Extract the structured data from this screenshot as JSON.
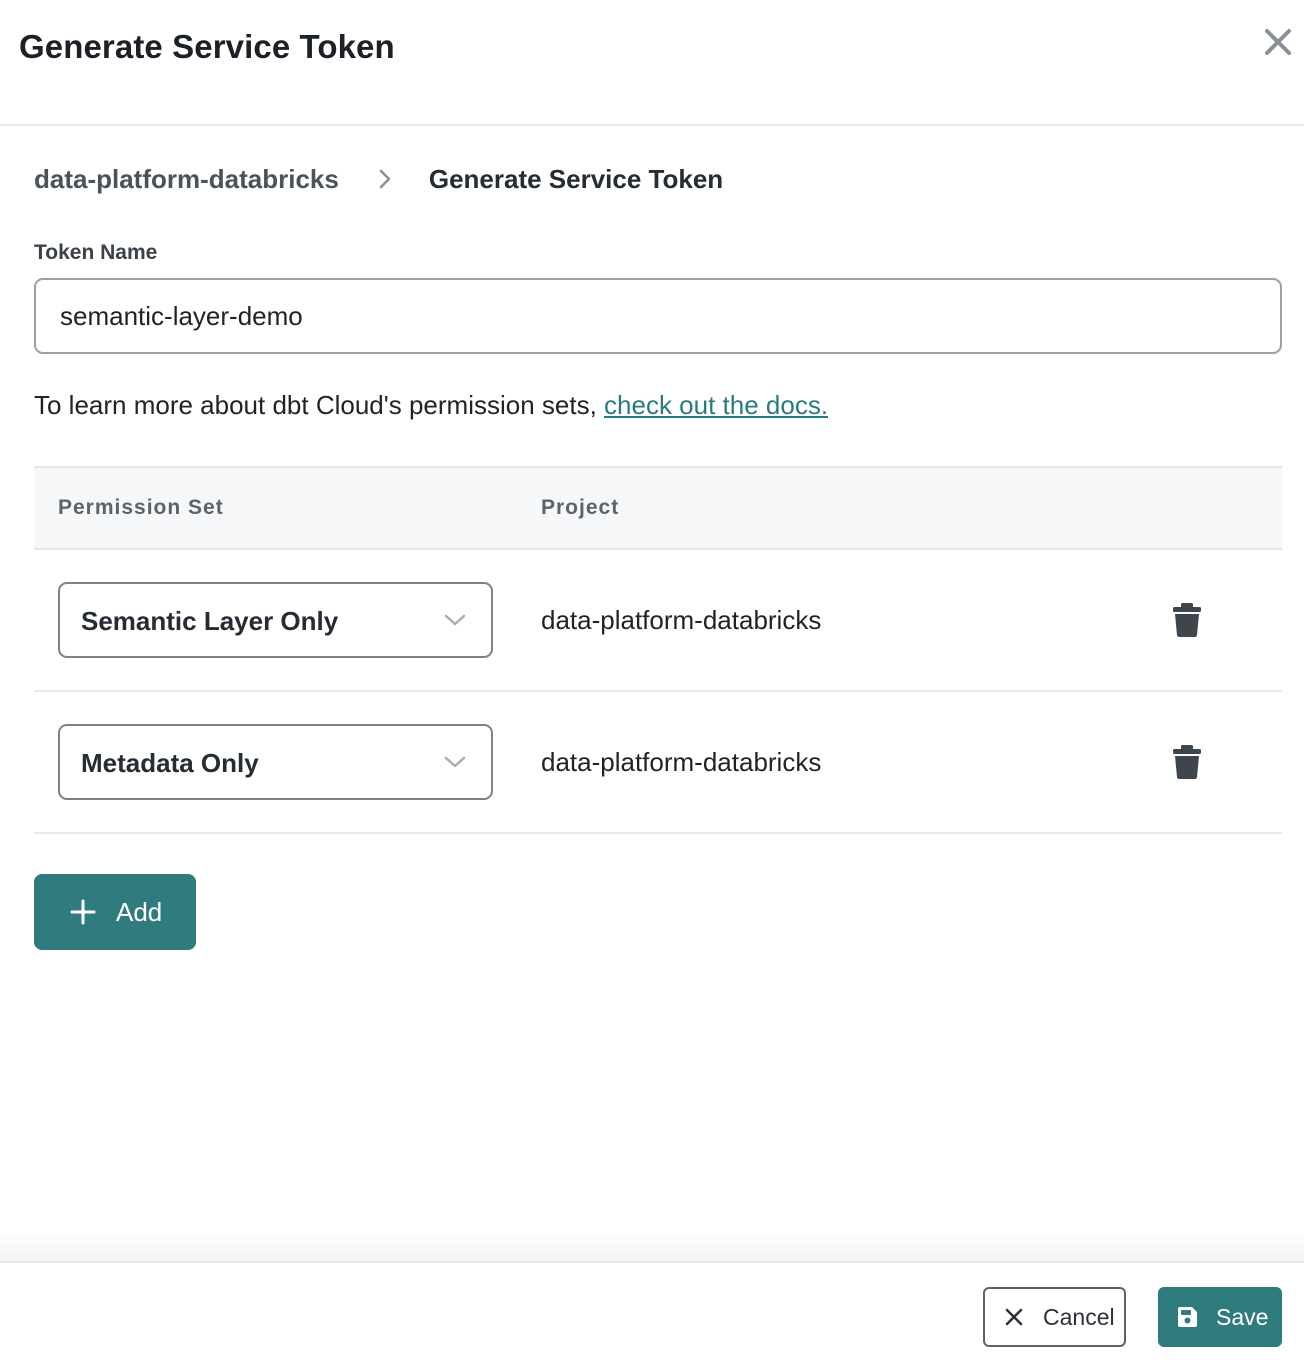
{
  "dialog": {
    "title": "Generate Service Token",
    "close_icon": "close-icon"
  },
  "breadcrumb": {
    "parent": "data-platform-databricks",
    "separator_icon": "chevron-right-icon",
    "current": "Generate Service Token"
  },
  "token_name": {
    "label": "Token Name",
    "value": "semantic-layer-demo"
  },
  "info": {
    "text": "To learn more about dbt Cloud's permission sets, ",
    "link": "check out the docs."
  },
  "table": {
    "headers": [
      "Permission Set",
      "Project"
    ],
    "rows": [
      {
        "permission_set": "Semantic Layer Only",
        "project": "data-platform-databricks",
        "delete_icon": "trash-icon"
      },
      {
        "permission_set": "Metadata Only",
        "project": "data-platform-databricks",
        "delete_icon": "trash-icon"
      }
    ]
  },
  "add_button": {
    "label": "Add",
    "icon": "plus-icon"
  },
  "footer": {
    "cancel_label": "Cancel",
    "cancel_icon": "close-icon",
    "save_label": "Save",
    "save_icon": "save-icon"
  },
  "colors": {
    "accent": "#2f7b7e",
    "link": "#2a7b7f",
    "border": "#e6e8ea",
    "header_bg": "#f6f7f8"
  }
}
